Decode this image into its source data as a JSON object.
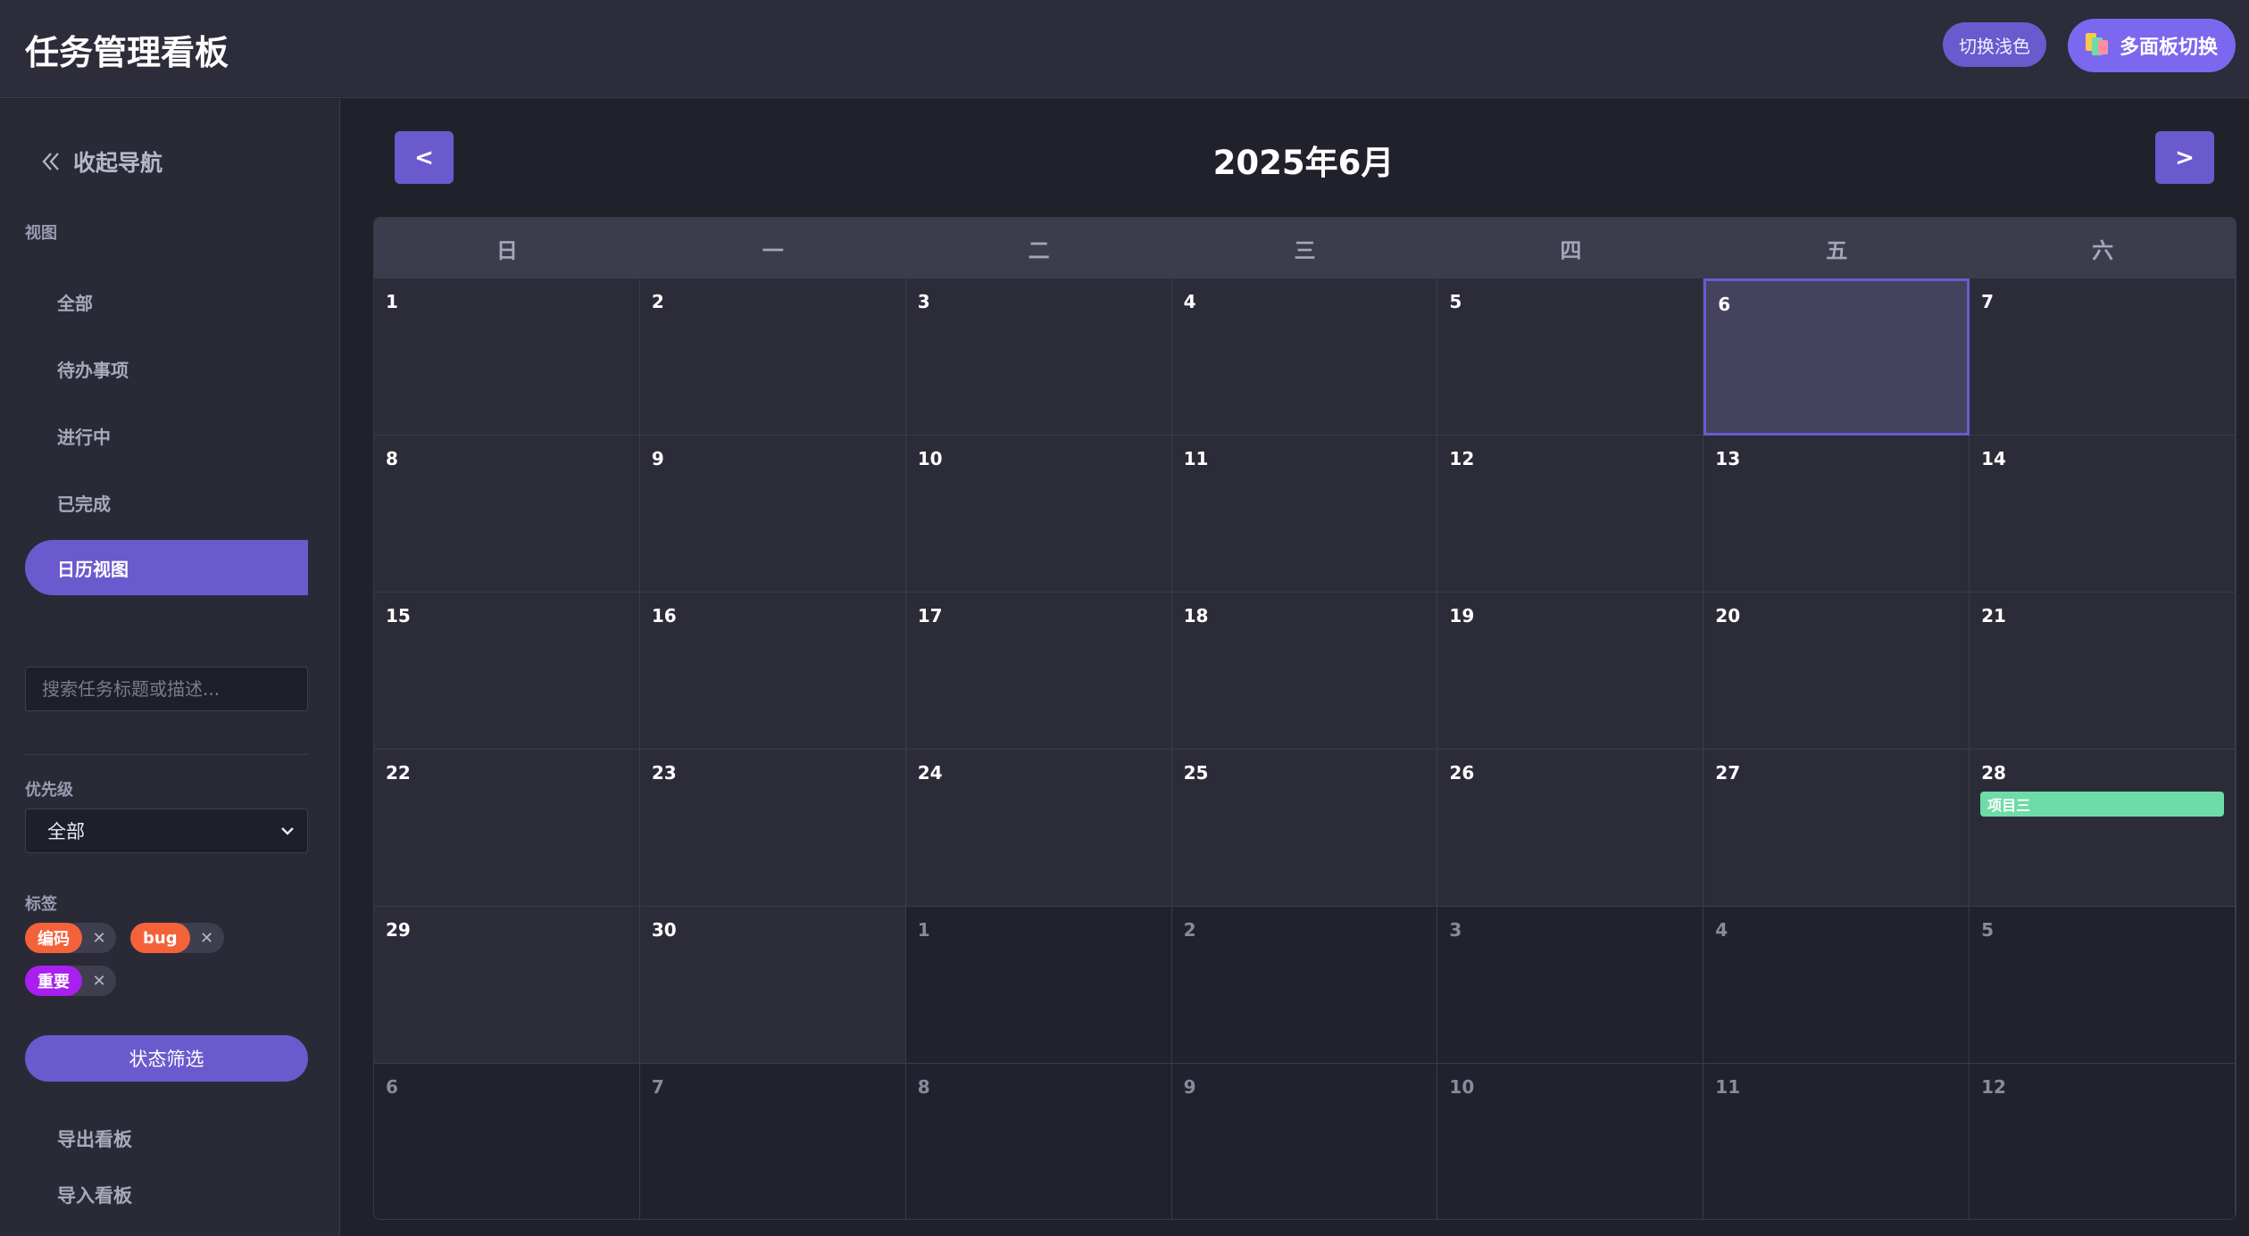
{
  "app": {
    "title": "任务管理看板",
    "theme_toggle_label": "切换浅色",
    "multi_board_label": "多面板切换"
  },
  "sidebar": {
    "collapse_label": "收起导航",
    "view_section_label": "视图",
    "nav_items": [
      {
        "label": "全部",
        "active": false
      },
      {
        "label": "待办事项",
        "active": false
      },
      {
        "label": "进行中",
        "active": false
      },
      {
        "label": "已完成",
        "active": false
      },
      {
        "label": "日历视图",
        "active": true
      }
    ],
    "search": {
      "placeholder": "搜索任务标题或描述...",
      "value": ""
    },
    "priority": {
      "label": "优先级",
      "selected": "全部"
    },
    "tags": {
      "label": "标签",
      "items": [
        {
          "name": "编码",
          "color": "#f4623a"
        },
        {
          "name": "bug",
          "color": "#f4623a"
        },
        {
          "name": "重要",
          "color": "#a81ff0"
        }
      ]
    },
    "filter_button_label": "状态筛选",
    "export_label": "导出看板",
    "import_label": "导入看板"
  },
  "calendar": {
    "title": "2025年6月",
    "prev_label": "<",
    "next_label": ">",
    "weekdays": [
      "日",
      "一",
      "二",
      "三",
      "四",
      "五",
      "六"
    ],
    "today": 6,
    "weeks": [
      [
        {
          "day": "1"
        },
        {
          "day": "2"
        },
        {
          "day": "3"
        },
        {
          "day": "4"
        },
        {
          "day": "5"
        },
        {
          "day": "6",
          "today": true
        },
        {
          "day": "7"
        }
      ],
      [
        {
          "day": "8"
        },
        {
          "day": "9"
        },
        {
          "day": "10"
        },
        {
          "day": "11"
        },
        {
          "day": "12"
        },
        {
          "day": "13"
        },
        {
          "day": "14"
        }
      ],
      [
        {
          "day": "15"
        },
        {
          "day": "16"
        },
        {
          "day": "17"
        },
        {
          "day": "18"
        },
        {
          "day": "19"
        },
        {
          "day": "20"
        },
        {
          "day": "21"
        }
      ],
      [
        {
          "day": "22"
        },
        {
          "day": "23"
        },
        {
          "day": "24"
        },
        {
          "day": "25"
        },
        {
          "day": "26"
        },
        {
          "day": "27"
        },
        {
          "day": "28",
          "events": [
            {
              "title": "项目三",
              "color": "#6ddca7"
            }
          ]
        }
      ],
      [
        {
          "day": "29"
        },
        {
          "day": "30"
        },
        {
          "day": "1",
          "out": true
        },
        {
          "day": "2",
          "out": true
        },
        {
          "day": "3",
          "out": true
        },
        {
          "day": "4",
          "out": true
        },
        {
          "day": "5",
          "out": true
        }
      ],
      [
        {
          "day": "6",
          "out": true
        },
        {
          "day": "7",
          "out": true
        },
        {
          "day": "8",
          "out": true
        },
        {
          "day": "9",
          "out": true
        },
        {
          "day": "10",
          "out": true
        },
        {
          "day": "11",
          "out": true
        },
        {
          "day": "12",
          "out": true
        }
      ]
    ]
  },
  "colors": {
    "accent": "#6a5acd",
    "accent_bright": "#7b68ee",
    "event_green": "#6ddca7"
  },
  "icons": {
    "collapse": "double-chevron-left-icon",
    "multi_board": "colored-panels-icon",
    "select_caret": "chevron-down-icon",
    "tag_remove": "close-icon"
  }
}
